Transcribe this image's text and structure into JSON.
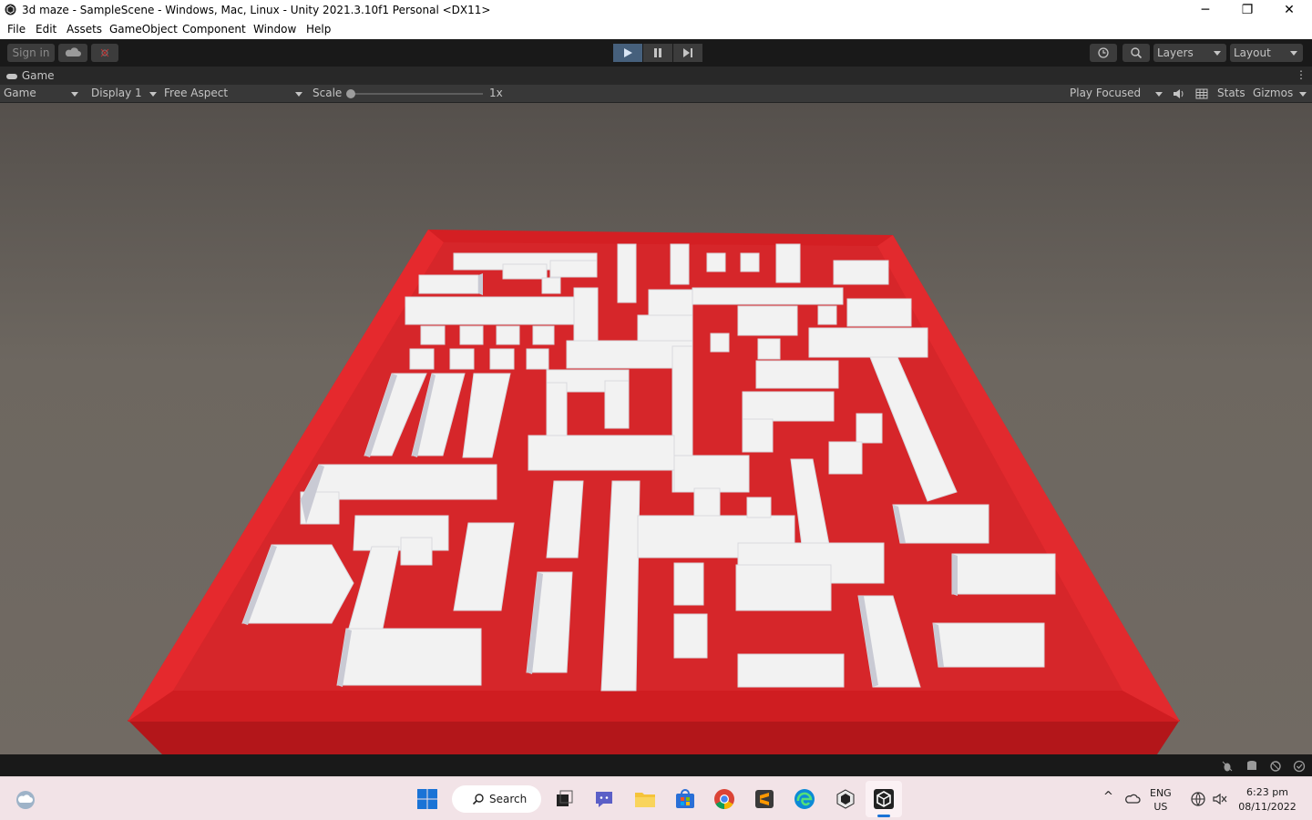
{
  "window": {
    "title": "3d maze - SampleScene - Windows, Mac, Linux - Unity 2021.3.10f1 Personal <DX11>",
    "minimize_glyph": "─",
    "restore_glyph": "❐",
    "close_glyph": "✕"
  },
  "menu": [
    "File",
    "Edit",
    "Assets",
    "GameObject",
    "Component",
    "Window",
    "Help"
  ],
  "toolbar": {
    "sign_in_label": "Sign in",
    "layers_label": "Layers",
    "layout_label": "Layout",
    "play_active": true
  },
  "tab": {
    "label": "Game"
  },
  "game_bar": {
    "mode": "Game",
    "display": "Display 1",
    "aspect": "Free Aspect",
    "scale_label": "Scale",
    "scale_value": "1x",
    "play_focused": "Play Focused",
    "stats": "Stats",
    "gizmos": "Gizmos"
  },
  "taskbar": {
    "search_label": "Search",
    "lang_line1": "ENG",
    "lang_line2": "US",
    "time": "6:23 pm",
    "date": "08/11/2022"
  },
  "colors": {
    "maze_floor": "#d41f23",
    "maze_wall_top": "#f4f4f4",
    "play_active": "#46607c"
  }
}
